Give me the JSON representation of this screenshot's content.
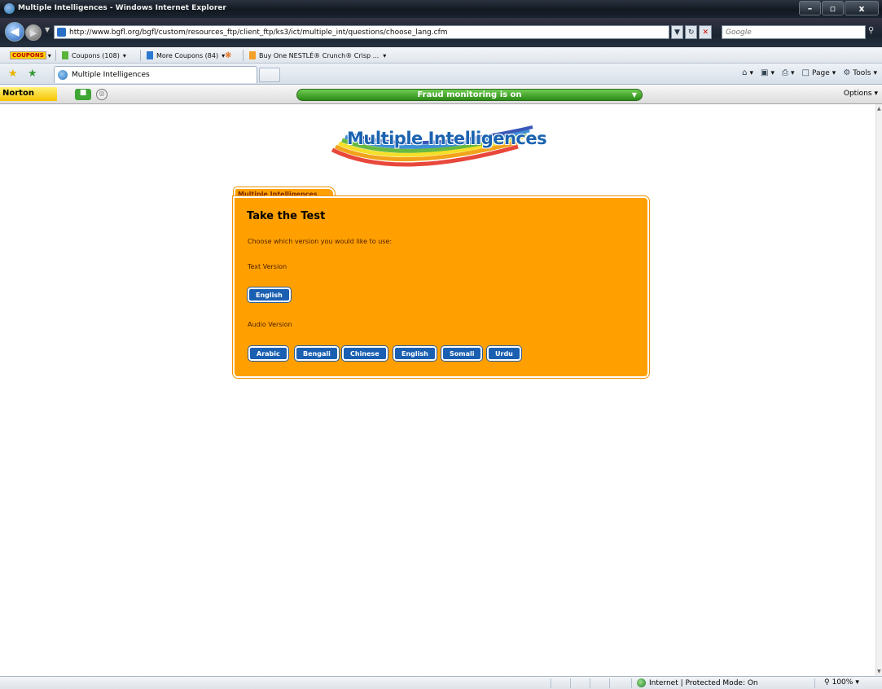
{
  "window": {
    "title": "Multiple Intelligences - Windows Internet Explorer",
    "controls": [
      "–",
      "▫",
      "x"
    ]
  },
  "address_bar": {
    "url": "http://www.bgfl.org/bgfl/custom/resources_ftp/client_ftp/ks3/ict/multiple_int/questions/choose_lang.cfm",
    "search_placeholder": "Google"
  },
  "coupons_toolbar": {
    "logo": "COUPONS",
    "coupons": "Coupons (108)",
    "more_coupons": "More Coupons (84)",
    "offer": "Buy One NESTLÉ® Crunch® Crisp ..."
  },
  "tabs": [
    {
      "title": "Multiple Intelligences",
      "active": true
    }
  ],
  "command_bar": {
    "page": "Page",
    "tools": "Tools"
  },
  "norton_bar": {
    "logo": "Norton",
    "fraud_status": "Fraud monitoring is on",
    "options": "Options"
  },
  "page": {
    "logo_text": "Multiple Intelligences",
    "panel_tab": "Multiple Intelligences",
    "heading": "Take the Test",
    "instruction": "Choose which version you would like to use:",
    "text_version_label": "Text Version",
    "text_buttons": [
      "English"
    ],
    "audio_version_label": "Audio Version",
    "audio_buttons": [
      "Arabic",
      "Bengali",
      "Chinese",
      "English",
      "Somali",
      "Urdu"
    ]
  },
  "status_bar": {
    "zone": "Internet | Protected Mode: On",
    "zoom": "100%"
  },
  "colors": {
    "panel_orange": "#ffa000",
    "button_blue": "#1a5fb1",
    "fraud_green": "#3fa535"
  }
}
